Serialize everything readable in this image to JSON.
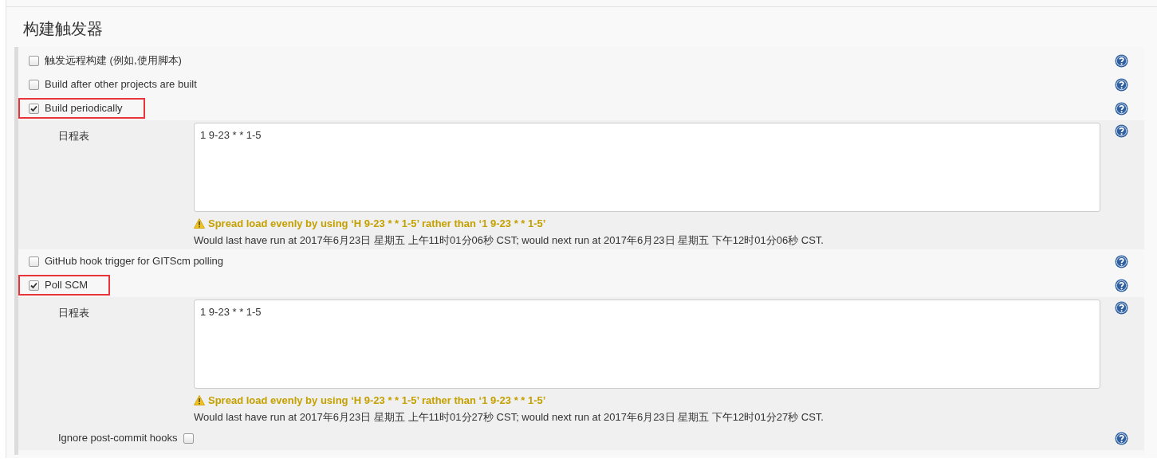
{
  "section": {
    "title": "构建触发器"
  },
  "triggers": [
    {
      "kind": "checkbox",
      "label": "触发远程构建 (例如,使用脚本)",
      "checked": false,
      "highlighted": false
    },
    {
      "kind": "checkbox",
      "label": "Build after other projects are built",
      "checked": false,
      "highlighted": false
    },
    {
      "kind": "checkbox",
      "label": "Build periodically",
      "checked": true,
      "highlighted": true,
      "children": [
        {
          "kind": "schedule",
          "label": "日程表",
          "value": "1 9-23 * * 1-5",
          "warning": "Spread load evenly by using ‘H 9-23 * * 1-5’ rather than ‘1 9-23 * * 1-5’",
          "info": "Would last have run at 2017年6月23日 星期五 上午11时01分06秒 CST; would next run at 2017年6月23日 星期五 下午12时01分06秒 CST."
        }
      ]
    },
    {
      "kind": "checkbox",
      "label": "GitHub hook trigger for GITScm polling",
      "checked": false,
      "highlighted": false
    },
    {
      "kind": "checkbox",
      "label": "Poll SCM",
      "checked": true,
      "highlighted": true,
      "children": [
        {
          "kind": "schedule",
          "label": "日程表",
          "value": "1 9-23 * * 1-5",
          "warning": "Spread load evenly by using ‘H 9-23 * * 1-5’ rather than ‘1 9-23 * * 1-5’",
          "info": "Would last have run at 2017年6月23日 星期五 上午11时01分27秒 CST; would next run at 2017年6月23日 星期五 下午12时01分27秒 CST."
        },
        {
          "kind": "option",
          "label": "Ignore post-commit hooks",
          "checked": false
        }
      ]
    }
  ]
}
